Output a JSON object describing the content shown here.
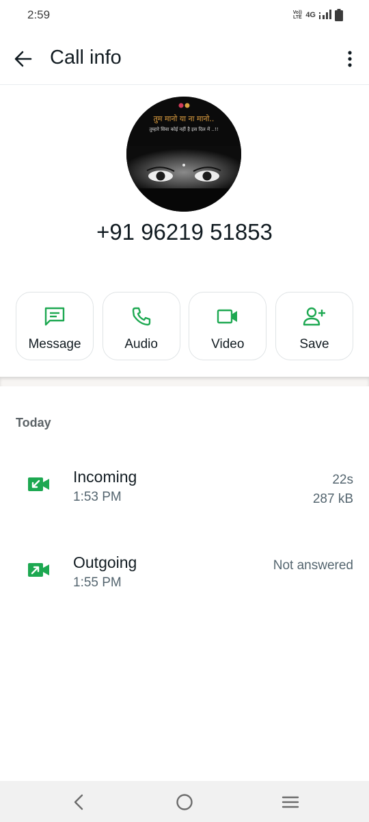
{
  "status_bar": {
    "time": "2:59",
    "volte_top": "Vo))",
    "volte_bottom": "LTE",
    "network": "4G"
  },
  "header": {
    "title": "Call info",
    "back_icon": "arrow-left-icon",
    "menu_icon": "more-vertical-icon"
  },
  "contact": {
    "phone_number": "+91 96219 51853",
    "avatar_caption_line1": "तुम मानो या ना मानो..",
    "avatar_caption_line2": "तुम्हारे सिवा कोई नहीं है इस दिल में ..!!"
  },
  "actions": [
    {
      "label": "Message",
      "icon": "message-icon"
    },
    {
      "label": "Audio",
      "icon": "phone-icon"
    },
    {
      "label": "Video",
      "icon": "video-icon"
    },
    {
      "label": "Save",
      "icon": "add-person-icon"
    }
  ],
  "history": {
    "section_title": "Today",
    "calls": [
      {
        "type": "Incoming",
        "time": "1:53 PM",
        "duration": "22s",
        "size": "287 kB",
        "icon": "incoming-video-call-icon"
      },
      {
        "type": "Outgoing",
        "time": "1:55 PM",
        "status": "Not answered",
        "icon": "outgoing-video-call-icon"
      }
    ]
  },
  "colors": {
    "accent_green": "#1da851",
    "text_primary": "#111b21",
    "text_secondary": "#54656f"
  }
}
